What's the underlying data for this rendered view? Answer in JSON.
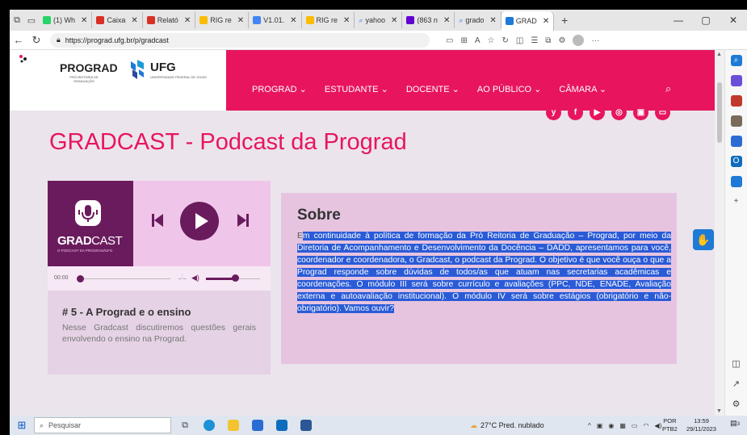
{
  "browser": {
    "tabs": [
      {
        "label": "(1) Wh",
        "color": "#25d366"
      },
      {
        "label": "Caixa",
        "color": "#d93025"
      },
      {
        "label": "Relató",
        "color": "#d93025"
      },
      {
        "label": "RIG re",
        "color": "#1a73e8"
      },
      {
        "label": "V1.01.",
        "color": "#4285f4"
      },
      {
        "label": "RIG re",
        "color": "#1a73e8"
      },
      {
        "label": "yahoo",
        "color": "#6001d2"
      },
      {
        "label": "(863 n",
        "color": "#6001d2"
      },
      {
        "label": "grado",
        "color": "#1a73e8"
      },
      {
        "label": "GRAD",
        "color": "#1e7ad6"
      }
    ],
    "url": "https://prograd.ufg.br/p/gradcast"
  },
  "site": {
    "prograd": "PROGRAD",
    "prograd_sub": "PRÓ-REITORIA DE GRADUAÇÃO",
    "ufg": "UFG",
    "ufg_sub": "UNIVERSIDADE FEDERAL DE GOIÁS",
    "menu": [
      "PROGRAD",
      "ESTUDANTE",
      "DOCENTE",
      "AO PÚBLICO",
      "CÂMARA"
    ],
    "socials": [
      "y",
      "f",
      "▶",
      "◎",
      "▣",
      "▭"
    ],
    "accent": "#e8155e",
    "purple": "#6a1b5d"
  },
  "page": {
    "title": "GRADCAST - Podcast da Prograd"
  },
  "player": {
    "cover_title_bold": "GRAD",
    "cover_title_rest": "CAST",
    "cover_sub": "O PODCAST DA PROGRAD/UFG",
    "time": "00:00",
    "progress_fraction": 0.0,
    "volume_fraction": 0.6,
    "episode_title": "# 5 - A Prograd e o ensino",
    "episode_desc": "Nesse Gradcast discutiremos questões gerais envolvendo o ensino na Prograd."
  },
  "sobre": {
    "heading": "Sobre",
    "text_first": "E",
    "text_selected": "m continuidade à política de formação da Pró Reitoria de Graduação – Prograd, por meio da Diretoria de Acompanhamento e Desenvolvimento da Docência – DADD, apresentamos para você, coordenador e coordenadora, o Gradcast, o podcast da Prograd. O objetivo é que você ouça o que a Prograd responde sobre dúvidas de todos/as que atuam nas secretarias acadêmicas e coordenações. O módulo III será sobre currículo e avaliações (PPC, NDE, ENADE, Avaliação externa e autoavaliação institucional). O módulo IV será sobre estágios (obrigatório e não-obrigatório). Vamos ouvir?"
  },
  "taskbar": {
    "search": "Pesquisar",
    "weather": "27°C Pred. nublado",
    "lang1": "POR",
    "lang2": "PTB2",
    "time": "13:59",
    "date": "29/11/2023",
    "notif": "3"
  }
}
